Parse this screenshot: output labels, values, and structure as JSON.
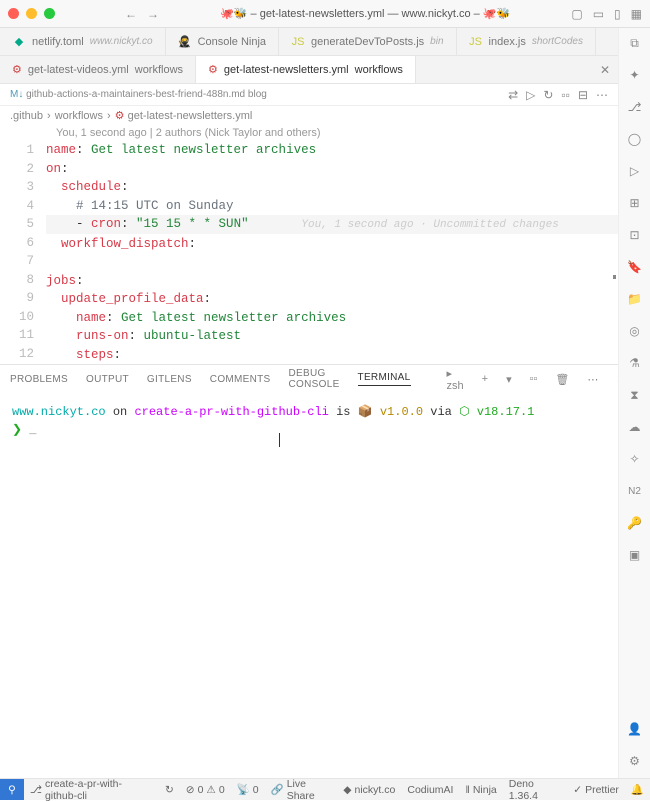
{
  "window": {
    "title": "🐙🐝 – get-latest-newsletters.yml — www.nickyt.co – 🐙🐝"
  },
  "tabs_top": [
    {
      "icon": "netlify",
      "label": "netlify.toml",
      "dim": "www.nickyt.co"
    },
    {
      "icon": "ninja",
      "label": "Console Ninja",
      "dim": ""
    },
    {
      "icon": "js",
      "label": "generateDevToPosts.js",
      "dim": "bin"
    },
    {
      "icon": "js",
      "label": "index.js",
      "dim": "shortCodes"
    }
  ],
  "tabs_files": [
    {
      "icon": "yaml",
      "label": "get-latest-videos.yml",
      "dim": "workflows"
    },
    {
      "icon": "yaml",
      "label": "get-latest-newsletters.yml",
      "dim": "workflows",
      "active": true
    }
  ],
  "open_editor": {
    "label": "github-actions-a-maintainers-best-friend-488n.md",
    "dim": "blog"
  },
  "breadcrumb": {
    "a": ".github",
    "b": "workflows",
    "c": "get-latest-newsletters.yml"
  },
  "authors": "You, 1 second ago | 2 authors (Nick Taylor and others)",
  "code": {
    "lines": [
      {
        "n": 1,
        "segs": [
          {
            "c": "k-key",
            "t": "name"
          },
          {
            "t": ": "
          },
          {
            "c": "k-str",
            "t": "Get latest newsletter archives"
          }
        ]
      },
      {
        "n": 2,
        "segs": [
          {
            "c": "k-key",
            "t": "on"
          },
          {
            "t": ":"
          }
        ]
      },
      {
        "n": 3,
        "segs": [
          {
            "t": "  "
          },
          {
            "c": "k-key",
            "t": "schedule"
          },
          {
            "t": ":"
          }
        ]
      },
      {
        "n": 4,
        "segs": [
          {
            "t": "    "
          },
          {
            "c": "k-cmt",
            "t": "# 14:15 UTC on Sunday"
          }
        ]
      },
      {
        "n": 5,
        "hl": true,
        "segs": [
          {
            "t": "    - "
          },
          {
            "c": "k-key",
            "t": "cron"
          },
          {
            "t": ": "
          },
          {
            "c": "k-str",
            "t": "\"15 15 * * SUN\""
          }
        ],
        "blame": "You, 1 second ago · Uncommitted changes"
      },
      {
        "n": 6,
        "segs": [
          {
            "t": "  "
          },
          {
            "c": "k-key",
            "t": "workflow_dispatch"
          },
          {
            "t": ":"
          }
        ]
      },
      {
        "n": 7,
        "segs": []
      },
      {
        "n": 8,
        "segs": [
          {
            "c": "k-key",
            "t": "jobs"
          },
          {
            "t": ":"
          }
        ]
      },
      {
        "n": 9,
        "segs": [
          {
            "t": "  "
          },
          {
            "c": "k-key",
            "t": "update_profile_data"
          },
          {
            "t": ":"
          }
        ]
      },
      {
        "n": 10,
        "segs": [
          {
            "t": "    "
          },
          {
            "c": "k-key",
            "t": "name"
          },
          {
            "t": ": "
          },
          {
            "c": "k-str",
            "t": "Get latest newsletter archives"
          }
        ]
      },
      {
        "n": 11,
        "segs": [
          {
            "t": "    "
          },
          {
            "c": "k-key",
            "t": "runs-on"
          },
          {
            "t": ": "
          },
          {
            "c": "k-str",
            "t": "ubuntu-latest"
          }
        ]
      },
      {
        "n": 12,
        "segs": [
          {
            "t": "    "
          },
          {
            "c": "k-key",
            "t": "steps"
          },
          {
            "t": ":"
          }
        ]
      }
    ]
  },
  "panel": {
    "tabs": [
      "PROBLEMS",
      "OUTPUT",
      "GITLENS",
      "COMMENTS",
      "DEBUG CONSOLE",
      "TERMINAL"
    ],
    "active": "TERMINAL",
    "shell": "zsh"
  },
  "terminal": {
    "line1": {
      "cwd": "www.nickyt.co",
      "on": " on ",
      "branch": "create-a-pr-with-github-cli",
      "is": " is ",
      "pkg": "📦 ",
      "ver": "v1.0.0",
      "via": " via ",
      "node": "⬡ ",
      "nodever": "v18.17.1"
    },
    "prompt": "❯ "
  },
  "status": {
    "branch": "create-a-pr-with-github-cli",
    "sync": "↻",
    "errors": "0",
    "warnings": "0",
    "ports": "0",
    "liveshare": "Live Share",
    "site": "nickyt.co",
    "codium": "CodiumAI",
    "ninja": "Ninja",
    "deno": "Deno 1.36.4",
    "prettier": "Prettier"
  }
}
